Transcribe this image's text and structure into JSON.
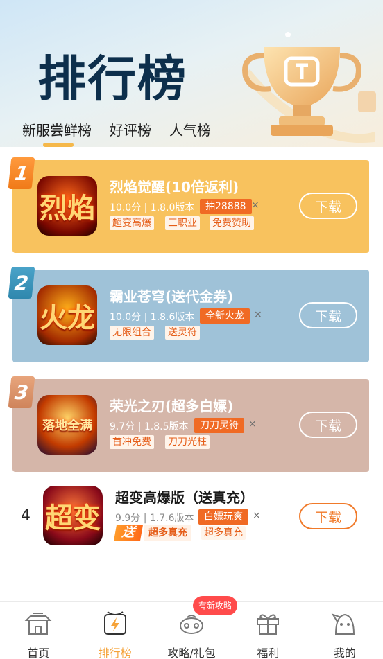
{
  "header": {
    "title": "排行榜"
  },
  "tabs": [
    {
      "label": "新服尝鲜榜",
      "active": true
    },
    {
      "label": "好评榜",
      "active": false
    },
    {
      "label": "人气榜",
      "active": false
    }
  ],
  "games": [
    {
      "rank": "1",
      "name": "烈焰觉醒(10倍返利)",
      "meta": "10.0分 | 1.8.0版本",
      "promo": "抽28888",
      "chips": [
        "超变高爆",
        "三职业",
        "免费赞助"
      ],
      "icon_text": "烈焰",
      "download_label": "下载"
    },
    {
      "rank": "2",
      "name": "霸业苍穹(送代金券)",
      "meta": "10.0分 | 1.8.6版本",
      "promo": "全新火龙",
      "chips": [
        "无限组合",
        "送灵符"
      ],
      "icon_text": "火龙",
      "download_label": "下载"
    },
    {
      "rank": "3",
      "name": "荣光之刃(超多白嫖)",
      "meta": "9.7分 | 1.8.5版本",
      "promo": "刀刀灵符",
      "chips": [
        "首冲免费",
        "刀刀光柱"
      ],
      "icon_text": "落地全满",
      "download_label": "下载"
    },
    {
      "rank": "4",
      "name": "超变高爆版（送真充）",
      "meta": "9.9分 | 1.7.6版本",
      "promo": "白嫖玩爽",
      "send_tag": "送",
      "send_text": "超多真充",
      "chips": [
        "超多真充"
      ],
      "icon_text": "超变",
      "download_label": "下载"
    }
  ],
  "bottom_nav": [
    {
      "label": "首页",
      "icon": "home-icon",
      "active": false
    },
    {
      "label": "排行榜",
      "icon": "ranking-icon",
      "active": true
    },
    {
      "label": "攻略/礼包",
      "icon": "guide-icon",
      "active": false
    },
    {
      "label": "福利",
      "icon": "gift-icon",
      "active": false
    },
    {
      "label": "我的",
      "icon": "profile-icon",
      "active": false
    }
  ],
  "nav_badge": "有新攻略",
  "colors": {
    "accent": "#f5a33a",
    "card1": "#f8c25e",
    "card2": "#9fc2d8",
    "card3": "#d5b6a9",
    "promo_orange": "#f06a24"
  }
}
